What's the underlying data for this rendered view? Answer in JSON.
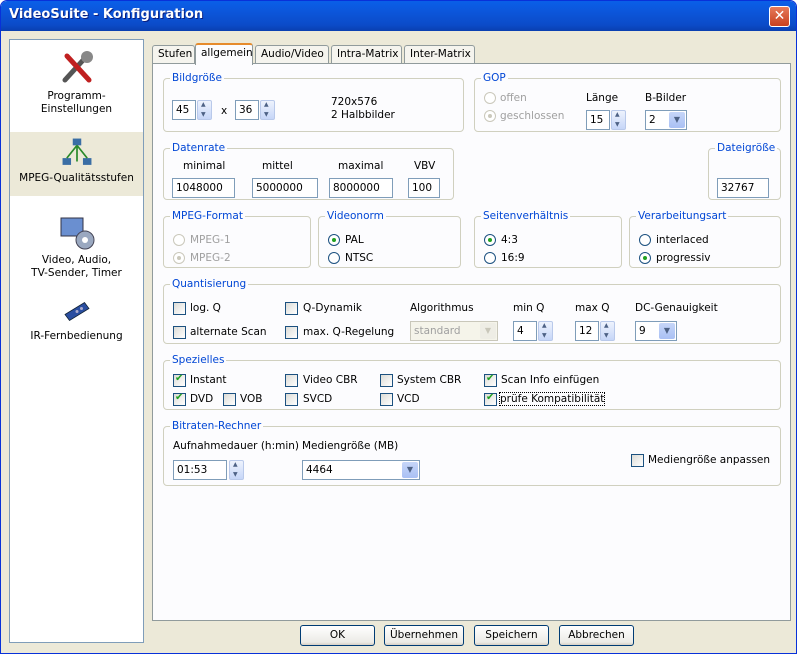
{
  "window": {
    "title": "VideoSuite - Konfiguration",
    "close_icon": "close-icon"
  },
  "sidebar": {
    "items": [
      {
        "label": "Programm-\nEinstellungen",
        "icon": "tools-icon"
      },
      {
        "label": "MPEG-Qualitätsstufen",
        "icon": "network-icon"
      },
      {
        "label": "Video, Audio,\nTV-Sender, Timer",
        "icon": "media-icon"
      },
      {
        "label": "IR-Fernbedienung",
        "icon": "remote-icon"
      }
    ]
  },
  "tabs": [
    "Stufen",
    "allgemein",
    "Audio/Video",
    "Intra-Matrix",
    "Inter-Matrix"
  ],
  "bildgroesse": {
    "legend": "Bildgröße",
    "width": "45",
    "x": "x",
    "height": "36",
    "res": "720x576",
    "fields": "2 Halbbilder"
  },
  "gop": {
    "legend": "GOP",
    "offen": "offen",
    "geschlossen": "geschlossen",
    "laenge_label": "Länge",
    "laenge": "15",
    "bbilder_label": "B-Bilder",
    "bbilder": "2"
  },
  "datenrate": {
    "legend": "Datenrate",
    "minimal_label": "minimal",
    "mittel_label": "mittel",
    "maximal_label": "maximal",
    "vbv_label": "VBV",
    "minimal": "1048000",
    "mittel": "5000000",
    "maximal": "8000000",
    "vbv": "100"
  },
  "dateigroesse": {
    "legend": "Dateigröße",
    "value": "32767"
  },
  "mpegformat": {
    "legend": "MPEG-Format",
    "opt1": "MPEG-1",
    "opt2": "MPEG-2"
  },
  "videonorm": {
    "legend": "Videonorm",
    "opt1": "PAL",
    "opt2": "NTSC"
  },
  "seitenverh": {
    "legend": "Seitenverhältnis",
    "opt1": "4:3",
    "opt2": "16:9"
  },
  "verarbeitung": {
    "legend": "Verarbeitungsart",
    "opt1": "interlaced",
    "opt2": "progressiv"
  },
  "quant": {
    "legend": "Quantisierung",
    "logq": "log. Q",
    "qdyn": "Q-Dynamik",
    "algo_label": "Algorithmus",
    "algo": "standard",
    "minq_label": "min Q",
    "minq": "4",
    "maxq_label": "max Q",
    "maxq": "12",
    "dc_label": "DC-Genauigkeit",
    "dc": "9",
    "altscan": "alternate Scan",
    "maxqreg": "max. Q-Regelung"
  },
  "spezielles": {
    "legend": "Spezielles",
    "instant": "Instant",
    "videocbr": "Video CBR",
    "systemcbr": "System CBR",
    "scaninfo": "Scan Info einfügen",
    "dvd": "DVD",
    "vob": "VOB",
    "svcd": "SVCD",
    "vcd": "VCD",
    "pruefe": "prüfe Kompatibilität"
  },
  "rechner": {
    "legend": "Bitraten-Rechner",
    "dauer_label": "Aufnahmedauer (h:min)",
    "dauer": "01:53",
    "medien_label": "Mediengröße (MB)",
    "medien": "4464",
    "anpassen": "Mediengröße anpassen"
  },
  "buttons": {
    "ok": "OK",
    "uebernehmen": "Übernehmen",
    "speichern": "Speichern",
    "abbrechen": "Abbrechen"
  }
}
